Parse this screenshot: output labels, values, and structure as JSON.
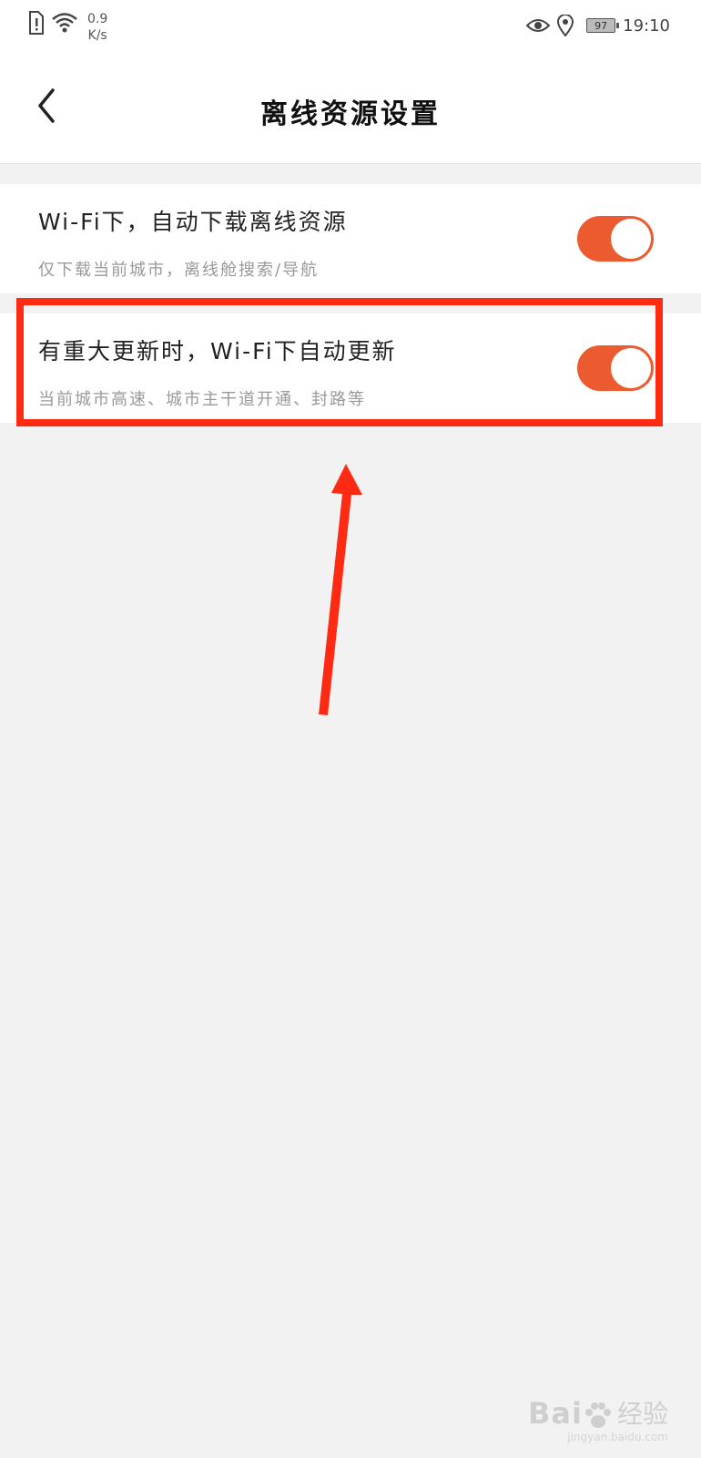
{
  "status_bar": {
    "speed_value": "0.9",
    "speed_unit": "K/s",
    "battery": "97",
    "time": "19:10"
  },
  "header": {
    "title": "离线资源设置"
  },
  "settings": [
    {
      "title": "Wi-Fi下，自动下载离线资源",
      "description": "仅下载当前城市，离线舱搜索/导航",
      "enabled": true
    },
    {
      "title": "有重大更新时，Wi-Fi下自动更新",
      "description": "当前城市高速、城市主干道开通、封路等",
      "enabled": true
    }
  ],
  "colors": {
    "accent": "#ec5a2f",
    "annotation": "#ff2a12"
  },
  "watermark": {
    "brand": "Bai",
    "brand_cn": "经验",
    "url": "jingyan.baidu.com"
  }
}
